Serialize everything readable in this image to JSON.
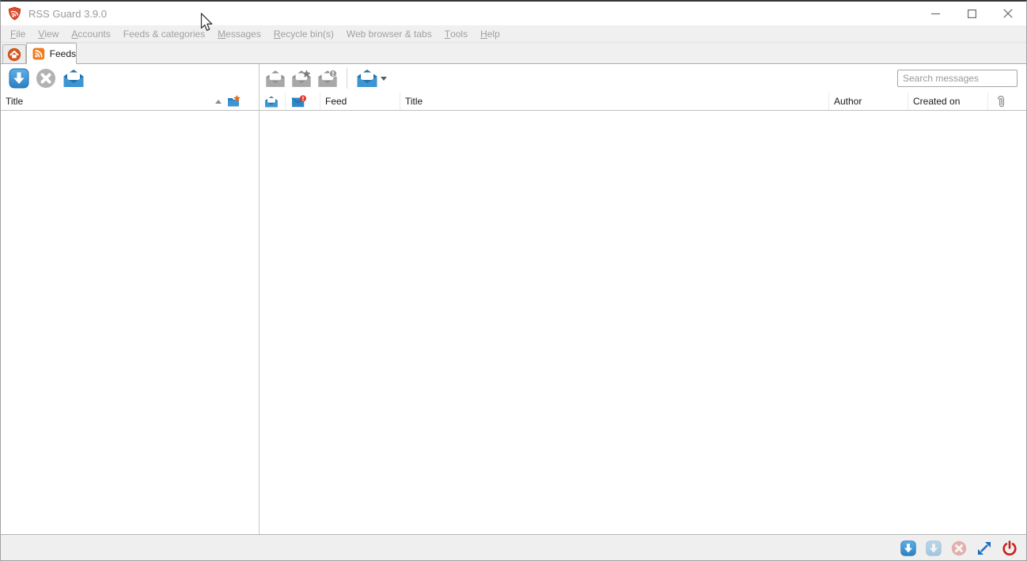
{
  "window": {
    "title": "RSS Guard 3.9.0"
  },
  "menubar": {
    "items": [
      {
        "pre": "",
        "key": "F",
        "post": "ile"
      },
      {
        "pre": "",
        "key": "V",
        "post": "iew"
      },
      {
        "pre": "",
        "key": "A",
        "post": "ccounts"
      },
      {
        "pre": "Feeds & categories",
        "key": "",
        "post": ""
      },
      {
        "pre": "",
        "key": "M",
        "post": "essages"
      },
      {
        "pre": "",
        "key": "R",
        "post": "ecycle bin(s)"
      },
      {
        "pre": "Web browser & tabs",
        "key": "",
        "post": ""
      },
      {
        "pre": "",
        "key": "T",
        "post": "ools"
      },
      {
        "pre": "",
        "key": "H",
        "post": "elp"
      }
    ]
  },
  "tabbar": {
    "feeds_tab_label": "Feeds",
    "home_tab_icon": "home-icon",
    "feeds_tab_icon": "rss-icon"
  },
  "feeds_panel": {
    "header_title": "Title",
    "sort_direction": "ascending",
    "toolbar_icons": [
      "update-feeds-icon",
      "stop-update-icon",
      "mark-feed-read-icon"
    ],
    "header_icons": [
      "folder-star-icon"
    ]
  },
  "messages_panel": {
    "search_placeholder": "Search messages",
    "toolbar_icons": [
      "mark-read-icon",
      "mark-starred-icon",
      "mark-important-icon",
      "mark-read-dropdown-icon"
    ],
    "columns": {
      "read": "read-status-icon",
      "importance": "importance-icon",
      "feed": "Feed",
      "title": "Title",
      "author": "Author",
      "created_on": "Created on",
      "attachments": "paperclip-icon"
    }
  },
  "statusbar": {
    "icons": [
      "update-feeds-icon",
      "update-all-feeds-icon",
      "stop-update-icon",
      "fullscreen-icon",
      "quit-icon"
    ]
  },
  "colors": {
    "accent_blue": "#2f87c8",
    "rss_orange": "#ee7b20",
    "logo_red": "#e14b2f",
    "power_red": "#c5221f",
    "badge_red": "#e23b2e",
    "disabled_gray": "#a8a8a8"
  }
}
